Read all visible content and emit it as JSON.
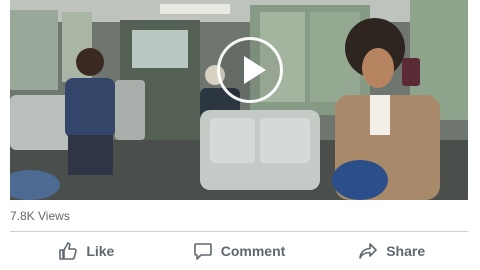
{
  "video": {
    "views_text": "7.8K Views",
    "play_icon": "play-icon"
  },
  "actions": {
    "like": {
      "label": "Like",
      "icon": "like-icon"
    },
    "comment": {
      "label": "Comment",
      "icon": "comment-icon"
    },
    "share": {
      "label": "Share",
      "icon": "share-icon"
    }
  },
  "colors": {
    "action_text": "#606770",
    "meta_text": "#65676b",
    "divider": "#ced0d4"
  }
}
